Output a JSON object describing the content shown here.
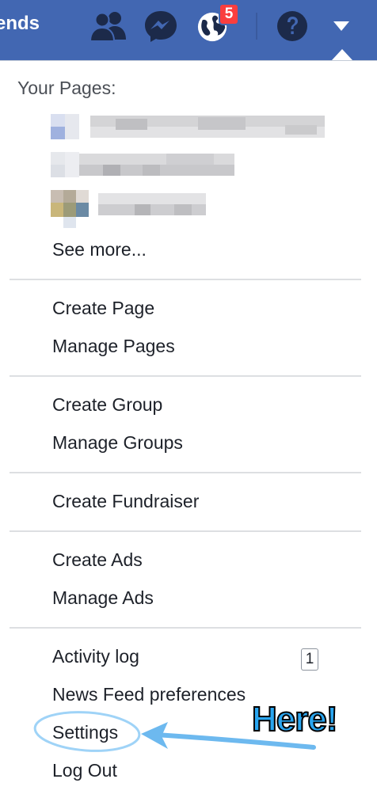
{
  "topbar": {
    "partial_title": "ends",
    "notifications_badge": "5",
    "icons": [
      "friends-icon",
      "messenger-icon",
      "globe-icon",
      "help-icon",
      "caret-down-icon"
    ]
  },
  "menu": {
    "pages_heading": "Your Pages:",
    "see_more": "See more...",
    "items": {
      "create_page": "Create Page",
      "manage_pages": "Manage Pages",
      "create_group": "Create Group",
      "manage_groups": "Manage Groups",
      "create_fundraiser": "Create Fundraiser",
      "create_ads": "Create Ads",
      "manage_ads": "Manage Ads",
      "activity_log": "Activity log",
      "activity_log_count": "1",
      "news_feed_preferences": "News Feed preferences",
      "settings": "Settings",
      "log_out": "Log Out"
    }
  },
  "annotation": {
    "label": "Here!",
    "color": "#2aa6f0"
  },
  "colors": {
    "brand": "#4267b2",
    "badge": "#fa3e3e"
  }
}
